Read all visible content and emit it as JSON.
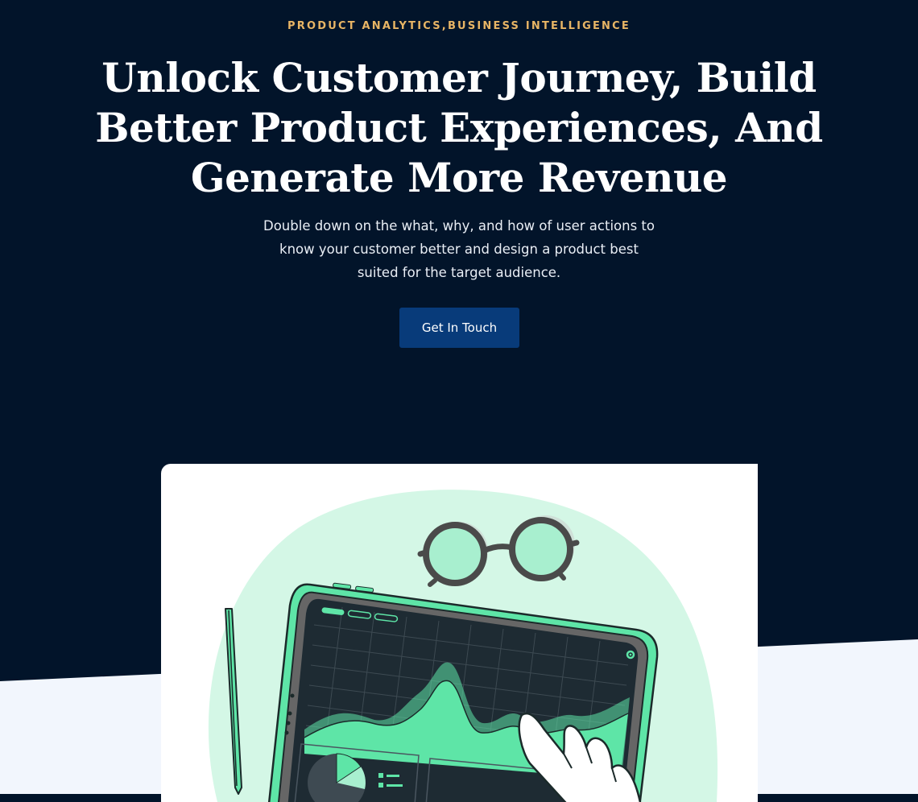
{
  "hero": {
    "eyebrow": "PRODUCT ANALYTICS,BUSINESS INTELLIGENCE",
    "headline": "Unlock Customer Journey, Build Better Product Experiences, And Generate More Revenue",
    "subtitle": "Double down on the what, why, and how of user actions to know your customer better and design a product best suited for the target audience.",
    "cta_label": "Get In Touch"
  },
  "illustration": {
    "icons": [
      "tablet-icon",
      "glasses-icon",
      "pen-icon",
      "hand-icon",
      "gear-icon",
      "pie-chart-icon"
    ]
  },
  "colors": {
    "background": "#02142a",
    "accent": "#e8b565",
    "button": "#083b7a",
    "illustration_mint": "#d4f7e6",
    "illustration_green": "#5ee5a7",
    "lower_band": "#f2f6fd"
  }
}
